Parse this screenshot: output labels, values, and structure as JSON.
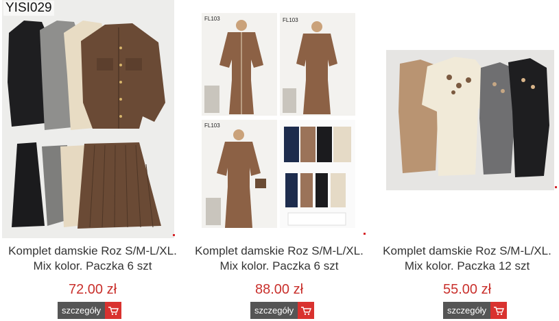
{
  "products": [
    {
      "image_label": "YISI029",
      "title_line1": "Komplet damskie Roz S/M-L/XL.",
      "title_line2": "Mix kolor. Paczka 6 szt",
      "price": "72.00 zł",
      "details_label": "szczegóły"
    },
    {
      "image_labels": [
        "FL103",
        "FL103",
        "FL103"
      ],
      "title_line1": "Komplet damskie Roz S/M-L/XL.",
      "title_line2": "Mix kolor. Paczka 6 szt",
      "price": "88.00 zł",
      "details_label": "szczegóły"
    },
    {
      "title_line1": "Komplet damskie Roz S/M-L/XL.",
      "title_line2": "Mix kolor. Paczka 12 szt",
      "price": "55.00 zł",
      "details_label": "szczegóły"
    }
  ],
  "icons": {
    "cart": "cart-icon"
  },
  "colors": {
    "price": "#c9302c",
    "details_bg": "#555555",
    "cart_bg": "#d9322f"
  }
}
